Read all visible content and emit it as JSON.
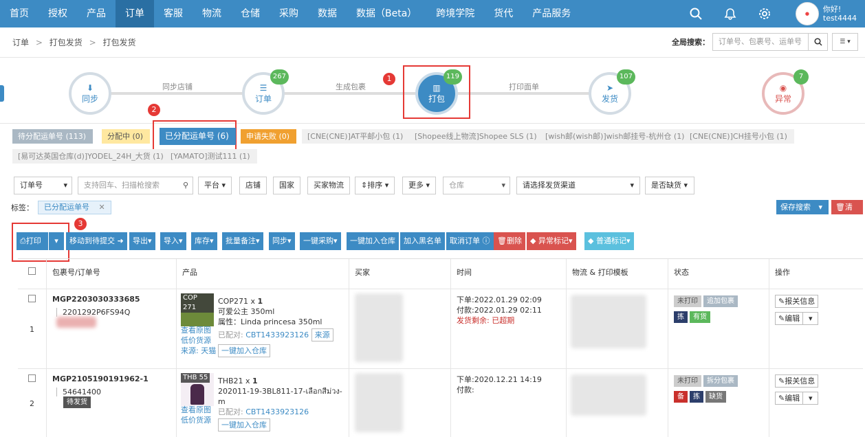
{
  "nav": {
    "items": [
      "首页",
      "授权",
      "产品",
      "订单",
      "客服",
      "物流",
      "仓储",
      "采购",
      "数据",
      "数据（Beta）",
      "跨境学院",
      "货代",
      "产品服务"
    ],
    "active_index": 3,
    "greeting": "你好!",
    "username": "test4444"
  },
  "breadcrumb": {
    "items": [
      "订单",
      "打包发货",
      "打包发货"
    ],
    "sep": ">"
  },
  "global_search": {
    "label": "全局搜索：",
    "placeholder": "订单号、包裹号、运单号"
  },
  "steps": {
    "nodes": [
      {
        "label": "同步"
      },
      {
        "label": "订单",
        "count": "267"
      },
      {
        "label": "打包",
        "count": "119"
      },
      {
        "label": "发货",
        "count": "107"
      },
      {
        "label": "异常",
        "count": "7"
      }
    ],
    "links": [
      "同步店铺",
      "生成包裹",
      "打印面单"
    ]
  },
  "annotations": [
    "1",
    "2",
    "3"
  ],
  "chips": [
    "待分配运单号 (113)",
    "分配中 (0)",
    "已分配运单号 (6)",
    "申请失败 (0)",
    "[CNE(CNE)]AT平邮小包 (1)",
    "[Shopee线上物流]Shopee SLS (1)",
    "[wish邮(wish邮)]wish邮挂号-杭州仓 (1)",
    "[CNE(CNE)]CH挂号小包 (1)",
    "[易可达英国仓库(d)]YODEL_24H_大货 (1)",
    "[YAMATO]测试111 (1)"
  ],
  "filters": {
    "order_no": "订单号",
    "search_placeholder": "支持回车、扫描枪搜索",
    "platform": "平台",
    "store": "店铺",
    "country": "国家",
    "buyer_logistics": "买家物流",
    "sort": "排序",
    "more": "更多",
    "warehouse": "仓库",
    "channel": "请选择发货渠道",
    "shortage": "是否缺货"
  },
  "tags": {
    "label": "标签：",
    "active": "已分配运单号"
  },
  "save_search": "保存搜索",
  "clear": "清空",
  "toolbar": {
    "print": "打印",
    "move": "移动到待提交",
    "export": "导出",
    "import": "导入",
    "stock": "库存",
    "batch_note": "批量备注",
    "sync": "同步",
    "purchase": "一键采购",
    "add_warehouse": "一键加入仓库",
    "blacklist": "加入黑名单",
    "cancel_order": "取消订单",
    "delete": "删除",
    "abnormal_mark": "异常标记",
    "normal_mark": "普通标记"
  },
  "table": {
    "headers": [
      "包裹号/订单号",
      "产品",
      "买家",
      "时间",
      "物流 & 打印模板",
      "状态",
      "操作"
    ],
    "rows": [
      {
        "index": "1",
        "package_no": "MGP2203030333685",
        "order_no": "2201292P6FS94Q",
        "sku_tag": "COP 271",
        "product_line": "COP271 x",
        "qty": "1",
        "product_name": "可爱公主 350ml",
        "attr": "属性：Linda princesa 350ml",
        "paired_label": "已配对:",
        "paired_code": "CBT1433923126",
        "source_btn": "来源",
        "link_view": "查看原图",
        "link_low": "低价货源",
        "source_text": "来源: 天猫",
        "add_warehouse_btn": "一键加入仓库",
        "time_order": "下单:2022.01.29 02:09",
        "time_paid": "付款:2022.01.29 02:11",
        "time_left": "发货剩余: 已超期",
        "status1": "未打印",
        "status2": "追加包裹",
        "status_pills": [
          {
            "t": "拣",
            "c": "#2c3e6b"
          },
          {
            "t": "有货",
            "c": "#5cb85c"
          }
        ],
        "op1": "报关信息",
        "op2": "编辑"
      },
      {
        "index": "2",
        "package_no": "MGP2105190191962-1",
        "order_no": "54641400",
        "order_tag": "待发货",
        "sku_tag": "THB 55",
        "product_line": "THB21 x",
        "qty": "1",
        "product_name": "202011-19-3BL811-17-เลือกสีม่วง-m",
        "attr": "",
        "paired_label": "已配对:",
        "paired_code": "CBT1433923126",
        "link_view": "查看原图",
        "link_low": "低价货源",
        "add_warehouse_btn": "一键加入仓库",
        "time_order": "下单:2020.12.21 14:19",
        "time_paid": "付款:",
        "status1": "未打印",
        "status2": "拆分包裹",
        "status_pills": [
          {
            "t": "备",
            "c": "#c9302c"
          },
          {
            "t": "拣",
            "c": "#2c3e6b"
          },
          {
            "t": "缺货",
            "c": "#777"
          }
        ],
        "op1": "报关信息",
        "op2": "编辑"
      }
    ]
  },
  "colors": {
    "primary": "#3d8bc4",
    "danger": "#d9534f",
    "success": "#5cb85c",
    "annotation": "#e53935"
  }
}
